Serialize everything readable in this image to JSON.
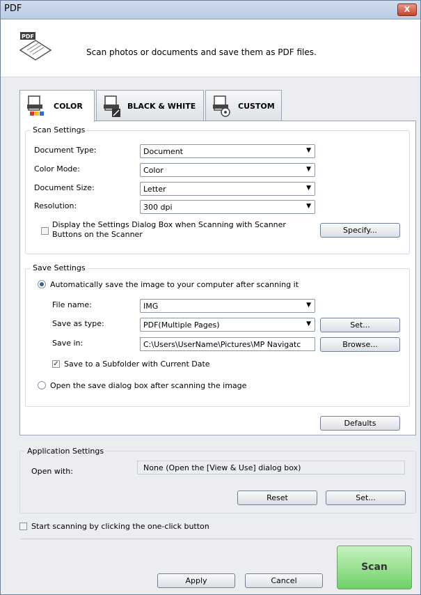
{
  "window": {
    "title": "PDF",
    "close_label": "X"
  },
  "header": {
    "description": "Scan photos or documents and save them as PDF files."
  },
  "tabs": [
    {
      "label": "COLOR",
      "active": true
    },
    {
      "label": "BLACK & WHITE",
      "active": false
    },
    {
      "label": "CUSTOM",
      "active": false
    }
  ],
  "scan_settings": {
    "title": "Scan Settings",
    "document_type_label": "Document Type:",
    "document_type_value": "Document",
    "color_mode_label": "Color Mode:",
    "color_mode_value": "Color",
    "document_size_label": "Document Size:",
    "document_size_value": "Letter",
    "resolution_label": "Resolution:",
    "resolution_value": "300 dpi",
    "display_dialog_label_1": "Display the Settings Dialog Box when Scanning with Scanner",
    "display_dialog_label_2": "Buttons on the Scanner",
    "display_dialog_checked": false,
    "specify_label": "Specify..."
  },
  "save_settings": {
    "title": "Save Settings",
    "auto_save_label": "Automatically save the image to your computer after scanning it",
    "auto_save_selected": true,
    "file_name_label": "File name:",
    "file_name_value": "IMG",
    "save_as_type_label": "Save as type:",
    "save_as_type_value": "PDF(Multiple Pages)",
    "set_label": "Set...",
    "save_in_label": "Save in:",
    "save_in_value": "C:\\Users\\UserName\\Pictures\\MP Navigatc",
    "browse_label": "Browse...",
    "subfolder_label": "Save to a Subfolder with Current Date",
    "subfolder_checked": true,
    "open_dialog_label": "Open the save dialog box after scanning the image",
    "open_dialog_selected": false
  },
  "defaults_label": "Defaults",
  "application_settings": {
    "title": "Application Settings",
    "open_with_label": "Open with:",
    "open_with_value": "None (Open the [View & Use] dialog box)",
    "reset_label": "Reset",
    "set_label": "Set..."
  },
  "one_click_label": "Start scanning by clicking the one-click button",
  "one_click_checked": false,
  "footer": {
    "apply_label": "Apply",
    "cancel_label": "Cancel",
    "scan_label": "Scan"
  },
  "colors": {
    "scan_button": "#6ed066",
    "titlebar": "#cfdcee",
    "close": "#c9442c"
  }
}
